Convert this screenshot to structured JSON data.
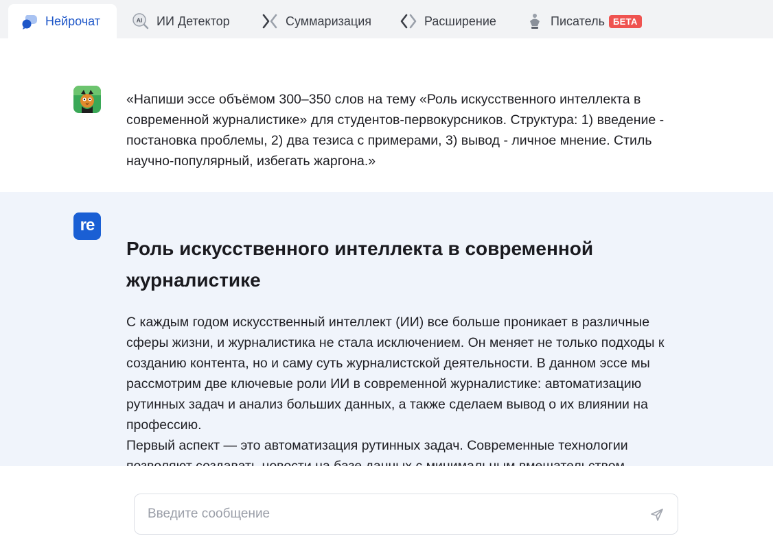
{
  "tabs": [
    {
      "label": "Нейрочат",
      "icon": "chat-bubbles-icon",
      "active": true
    },
    {
      "label": "ИИ Детектор",
      "icon": "ai-detector-icon",
      "active": false
    },
    {
      "label": "Суммаризация",
      "icon": "summarize-icon",
      "active": false
    },
    {
      "label": "Расширение",
      "icon": "code-brackets-icon",
      "active": false
    },
    {
      "label": "Писатель",
      "icon": "pen-nib-icon",
      "active": false,
      "badge": "БЕТА"
    }
  ],
  "conversation": {
    "user_message": "«Напиши эссе объёмом 300–350 слов на тему «Роль искусственного интеллекта в современной журналистике» для студентов-первокурсников. Структура: 1) введение - постановка проблемы, 2) два тезиса с примерами, 3) вывод - личное мнение. Стиль научно-популярный, избегать жаргона.»",
    "bot_logo_text": "re",
    "bot_title": "Роль искусственного интеллекта в современной журналистике",
    "bot_paragraph_1": "С каждым годом искусственный интеллект (ИИ) все больше проникает в различные сферы жизни, и журналистика не стала исключением. Он меняет не только подходы к созданию контента, но и саму суть журналистской деятельности. В данном эссе мы рассмотрим две ключевые роли ИИ в современной журналистике: автоматизацию рутинных задач и анализ больших данных, а также сделаем вывод о их влиянии на профессию.",
    "bot_paragraph_2": "Первый аспект — это автоматизация рутинных задач. Современные технологии позволяют создавать новости на базе данных с минимальным вмешательством"
  },
  "composer": {
    "placeholder": "Введите сообщение",
    "value": ""
  },
  "colors": {
    "accent": "#1d56c8",
    "bot_bg": "#f0f4fb",
    "badge": "#ef5350"
  }
}
